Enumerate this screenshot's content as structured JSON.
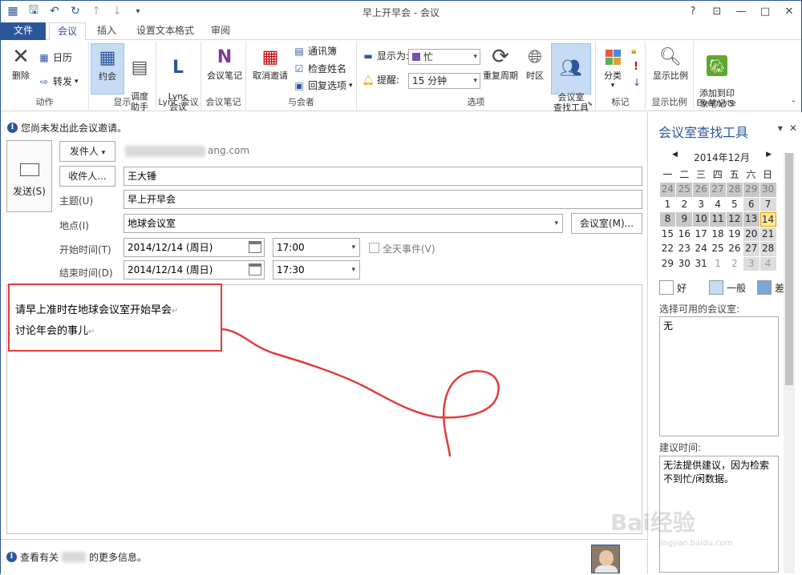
{
  "window": {
    "title": "早上开早会 - 会议"
  },
  "qat": {
    "icons": [
      "calendar-icon",
      "save-icon",
      "undo-icon",
      "redo-icon",
      "up-icon",
      "down-icon",
      "customize-icon"
    ]
  },
  "window_controls": {
    "help": "?",
    "restore_ribbon": "⊡",
    "minimize": "—",
    "maximize": "□",
    "close": "✕"
  },
  "tabs": [
    {
      "label": "文件"
    },
    {
      "label": "会议"
    },
    {
      "label": "插入"
    },
    {
      "label": "设置文本格式"
    },
    {
      "label": "审阅"
    }
  ],
  "ribbon": {
    "actions": {
      "label": "动作",
      "delete": "删除",
      "calendar": "日历",
      "forward": "转发"
    },
    "show": {
      "label": "显示",
      "appointment": "约会",
      "scheduling": "调度\n助手"
    },
    "lync": {
      "label": "Lync 会议",
      "button": "Lync\n会议"
    },
    "notes": {
      "label": "会议笔记",
      "button": "会议笔记"
    },
    "attendees": {
      "label": "与会者",
      "cancel": "取消邀请",
      "address_book": "通讯簿",
      "check_names": "检查姓名",
      "response_options": "回复选项"
    },
    "options": {
      "label": "选项",
      "show_as_label": "显示为:",
      "show_as_value": "忙",
      "reminder_label": "提醒:",
      "reminder_value": "15 分钟",
      "recurrence": "重复周期",
      "timezone": "时区",
      "room_finder": "会议室\n查找工具"
    },
    "tags": {
      "label": "标记",
      "categorize": "分类"
    },
    "zoom": {
      "label": "显示比例",
      "button": "显示比例"
    },
    "evernote": {
      "label": "Evernote",
      "button": "添加到印\n象笔记 5"
    }
  },
  "form": {
    "notice": "您尚未发出此会议邀请。",
    "send": "发送(S)",
    "from_button": "发件人",
    "from_value": "ang.com",
    "to_button": "收件人...",
    "to_value": "王大锤",
    "subject_label": "主题(U)",
    "subject_value": "早上开早会",
    "location_label": "地点(I)",
    "location_value": "地球会议室",
    "rooms_button": "会议室(M)...",
    "start_label": "开始时间(T)",
    "start_date": "2014/12/14 (周日)",
    "start_time": "17:00",
    "allday_label": "全天事件(V)",
    "end_label": "结束时间(D)",
    "end_date": "2014/12/14 (周日)",
    "end_time": "17:30"
  },
  "body": {
    "line1": "请早上准时在地球会议室开始早会",
    "line2": "讨论年会的事儿",
    "para_mark": "↵"
  },
  "bottom": {
    "info_prefix": "查看有关",
    "info_suffix": "的更多信息。"
  },
  "pane": {
    "title": "会议室查找工具",
    "month": "2014年12月",
    "weekdays": [
      "一",
      "二",
      "三",
      "四",
      "五",
      "六",
      "日"
    ],
    "weeks": [
      [
        "24",
        "25",
        "26",
        "27",
        "28",
        "29",
        "30"
      ],
      [
        "1",
        "2",
        "3",
        "4",
        "5",
        "6",
        "7"
      ],
      [
        "8",
        "9",
        "10",
        "11",
        "12",
        "13",
        "14"
      ],
      [
        "15",
        "16",
        "17",
        "18",
        "19",
        "20",
        "21"
      ],
      [
        "22",
        "23",
        "24",
        "25",
        "26",
        "27",
        "28"
      ],
      [
        "29",
        "30",
        "31",
        "1",
        "2",
        "3",
        "4"
      ]
    ],
    "legend": {
      "good": "好",
      "fair": "一般",
      "poor": "差"
    },
    "legend_colors": {
      "good": "#ffffff",
      "fair": "#c5dcf4",
      "poor": "#7aa6dc"
    },
    "rooms_label": "选择可用的会议室:",
    "rooms_value": "无",
    "suggest_label": "建议时间:",
    "suggest_value": "无法提供建议，因为检索不到忙/闲数据。"
  },
  "watermark": {
    "text": "Bai经验",
    "sub": "jingyan.baidu.com"
  }
}
